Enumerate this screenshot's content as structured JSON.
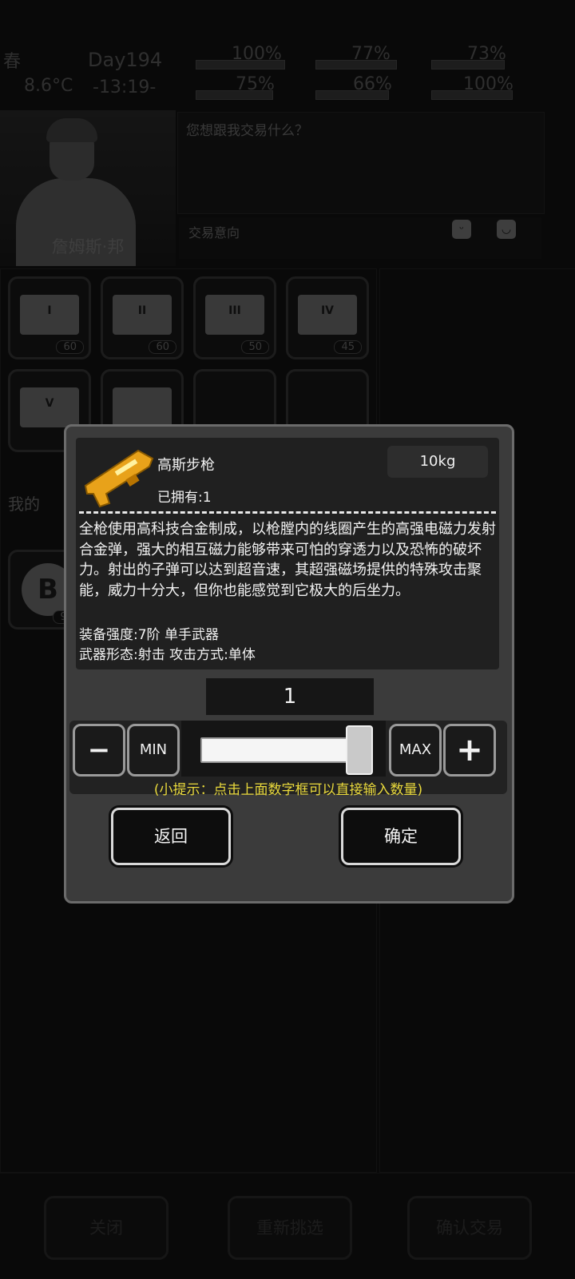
{
  "status": {
    "season": "春",
    "temperature": "8.6°C",
    "day": "Day194",
    "time": "-13:19-",
    "stats": [
      "100%",
      "75%",
      "77%",
      "66%",
      "73%",
      "100%"
    ]
  },
  "npc": {
    "name": "詹姆斯·邦",
    "dialog": "您想跟我交易什么？",
    "intent_label": "交易意向"
  },
  "inventory": {
    "crates": [
      {
        "numeral": "I",
        "count": "60"
      },
      {
        "numeral": "II",
        "count": "60"
      },
      {
        "numeral": "III",
        "count": "50"
      },
      {
        "numeral": "IV",
        "count": "45"
      },
      {
        "numeral": "V",
        "count": ""
      },
      {
        "numeral": "",
        "count": ""
      }
    ],
    "mine_label": "我的",
    "coin_count": "99"
  },
  "bottom": {
    "close": "关闭",
    "reselect": "重新挑选",
    "confirm_trade": "确认交易"
  },
  "modal": {
    "item_name": "高斯步枪",
    "weight": "10kg",
    "owned": "已拥有:1",
    "description": "全枪使用高科技合金制成，以枪膛内的线圈产生的高强电磁力发射合金弹，强大的相互磁力能够带来可怕的穿透力以及恐怖的破坏力。射出的子弹可以达到超音速，其超强磁场提供的特殊攻击聚能，威力十分大，但你也能感觉到它极大的后坐力。",
    "equip_level": "装备强度:7阶 单手武器",
    "weapon_form": "武器形态:射击 攻击方式:单体",
    "quantity": "1",
    "slider_fraction": 1.0,
    "min_label": "MIN",
    "max_label": "MAX",
    "minus_symbol": "−",
    "plus_symbol": "+",
    "hint": "(小提示：点击上面数字框可以直接输入数量)",
    "back": "返回",
    "ok": "确定"
  },
  "colors": {
    "gun": "#e8a21a",
    "hint": "#e9d93c"
  }
}
